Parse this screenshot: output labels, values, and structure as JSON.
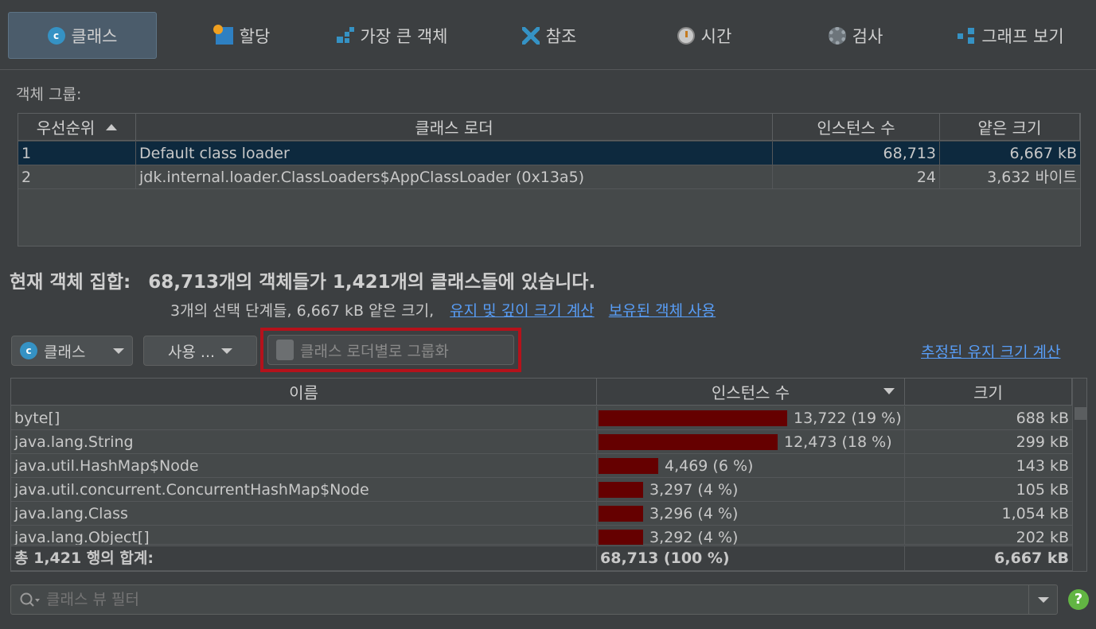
{
  "tabs": [
    {
      "label": "클래스",
      "icon": "class-icon"
    },
    {
      "label": "할당",
      "icon": "allocation-icon"
    },
    {
      "label": "가장 큰 객체",
      "icon": "biggest-objects-icon"
    },
    {
      "label": "참조",
      "icon": "references-icon"
    },
    {
      "label": "시간",
      "icon": "time-icon"
    },
    {
      "label": "검사",
      "icon": "inspections-icon"
    },
    {
      "label": "그래프 보기",
      "icon": "graph-icon"
    }
  ],
  "object_groups": {
    "label": "객체 그룹:",
    "columns": [
      "우선순위",
      "클래스 로더",
      "인스턴스 수",
      "얕은 크기"
    ],
    "rows": [
      {
        "priority": "1",
        "loader": "Default class loader",
        "instances": "68,713",
        "size": "6,667 kB"
      },
      {
        "priority": "2",
        "loader": "jdk.internal.loader.ClassLoaders$AppClassLoader (0x13a5)",
        "instances": "24",
        "size": "3,632 바이트"
      }
    ]
  },
  "summary": {
    "title_prefix": "현재 객체 집합:",
    "title_text": "68,713개의 객체들가 1,421개의 클래스들에 있습니다.",
    "detail": "3개의 선택 단계들, 6,667 kB 얕은 크기,",
    "link_retained": "유지 및 깊이 크기 계산",
    "link_use_retained": "보유된 객체 사용"
  },
  "toolbar": {
    "view_select": "클래스",
    "use_button": "사용 ...",
    "group_button": "클래스 로더별로 그룹화",
    "estimate_link": "추정된 유지 크기 계산"
  },
  "class_table": {
    "columns": [
      "이름",
      "인스턴스 수",
      "크기"
    ],
    "rows": [
      {
        "name": "byte[]",
        "instances": "13,722 (19 %)",
        "fraction": 0.19,
        "size": "688 kB"
      },
      {
        "name": "java.lang.String",
        "instances": "12,473 (18 %)",
        "fraction": 0.18,
        "size": "299 kB"
      },
      {
        "name": "java.util.HashMap$Node",
        "instances": "4,469 (6 %)",
        "fraction": 0.06,
        "size": "143 kB"
      },
      {
        "name": "java.util.concurrent.ConcurrentHashMap$Node",
        "instances": "3,297 (4 %)",
        "fraction": 0.04,
        "size": "105 kB"
      },
      {
        "name": "java.lang.Class",
        "instances": "3,296 (4 %)",
        "fraction": 0.04,
        "size": "1,054 kB"
      },
      {
        "name": "java.lang.Object[]",
        "instances": "3,292 (4 %)",
        "fraction": 0.04,
        "size": "202 kB"
      }
    ],
    "totals": {
      "label": "총 1,421 행의 합계:",
      "instances": "68,713 (100 %)",
      "size": "6,667 kB"
    }
  },
  "filter": {
    "placeholder": "클래스 뷰 필터"
  },
  "colors": {
    "background": "#3c3f41",
    "selection": "#0d293e",
    "bar": "#650000",
    "link": "#589df6",
    "highlight": "#b5121b"
  }
}
